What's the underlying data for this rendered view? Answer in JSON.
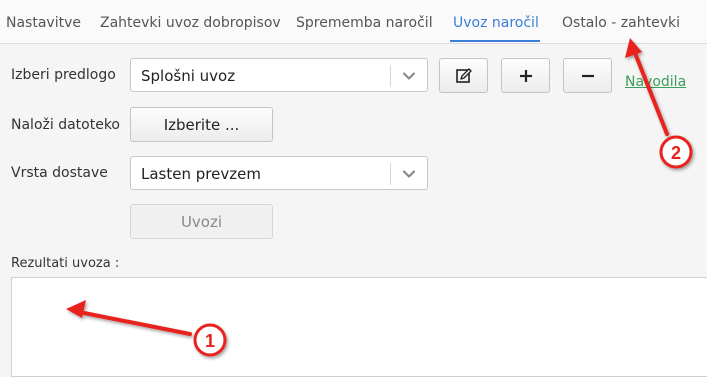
{
  "tabs": [
    {
      "label": "Nastavitve",
      "active": false
    },
    {
      "label": "Zahtevki uvoz dobropisov",
      "active": false
    },
    {
      "label": "Sprememba naročil",
      "active": false
    },
    {
      "label": "Uvoz naročil",
      "active": true
    },
    {
      "label": "Ostalo - zahtevki",
      "active": false
    }
  ],
  "form": {
    "template_label": "Izberi predlogo",
    "template_value": "Splošni uvoz",
    "upload_label": "Naloži datoteko",
    "upload_button": "Izberite ...",
    "delivery_label": "Vrsta dostave",
    "delivery_value": "Lasten prevzem",
    "import_button": "Uvozi",
    "instructions_link": "Navodila"
  },
  "results": {
    "label": "Rezultati uvoza :"
  },
  "annotations": {
    "marker_1": "1",
    "marker_2": "2",
    "color": "#e8201c"
  },
  "colors": {
    "accent": "#3b7dd8",
    "link": "#3c9e5a"
  },
  "icons": [
    "edit-icon",
    "plus-icon",
    "minus-icon",
    "chevron-down-icon"
  ]
}
